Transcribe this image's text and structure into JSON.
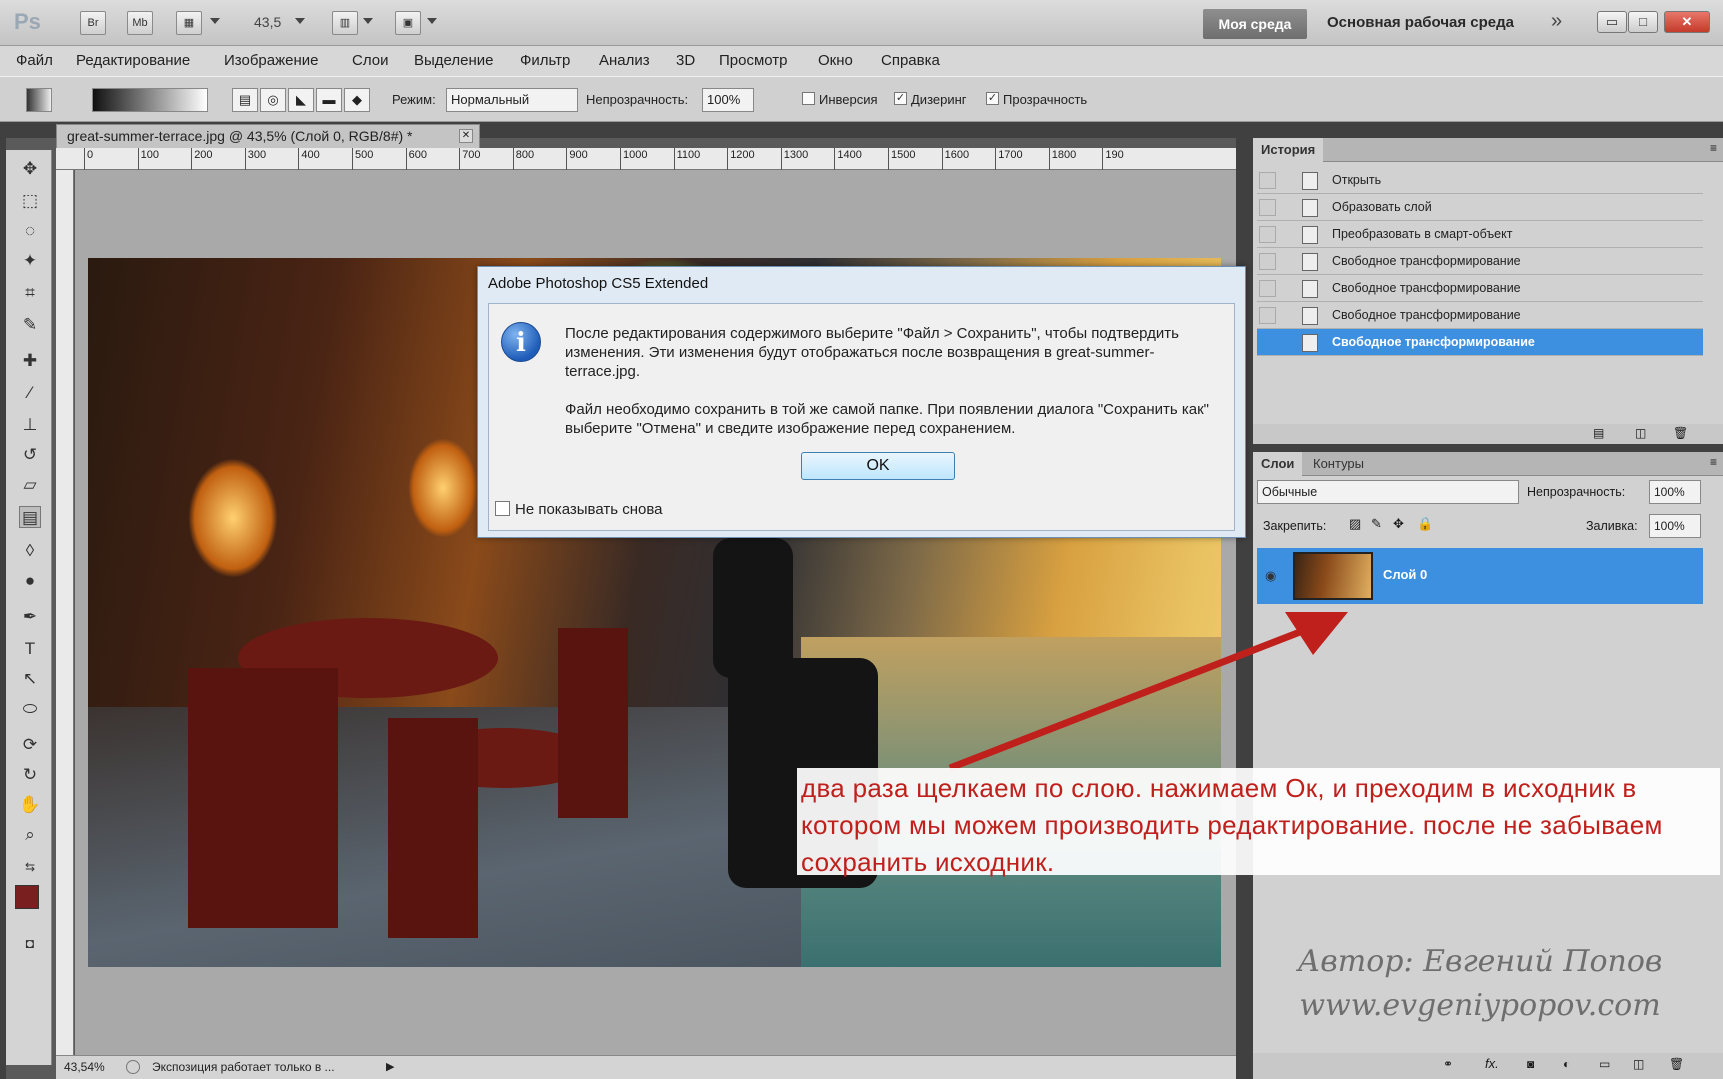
{
  "appbar": {
    "logo": "Ps",
    "buttons": [
      "Br",
      "Mb"
    ],
    "zoom": "43,5",
    "workspace_active": "Моя среда",
    "workspace_main": "Основная рабочая среда",
    "more": "»",
    "win_min": "▭",
    "win_max": "□",
    "win_close": "✕"
  },
  "menu": [
    "Файл",
    "Редактирование",
    "Изображение",
    "Слои",
    "Выделение",
    "Фильтр",
    "Анализ",
    "3D",
    "Просмотр",
    "Окно",
    "Справка"
  ],
  "options": {
    "mode_label": "Режим:",
    "mode_value": "Нормальный",
    "opacity_label": "Непрозрачность:",
    "opacity_value": "100%",
    "inverse_label": "Инверсия",
    "dither_label": "Дизеринг",
    "transparency_label": "Прозрачность",
    "inverse_checked": false,
    "dither_checked": true,
    "transparency_checked": true
  },
  "document": {
    "tab_title": "great-summer-terrace.jpg @ 43,5% (Слой 0, RGB/8#) *",
    "ruler_labels": [
      "0",
      "100",
      "200",
      "300",
      "400",
      "500",
      "600",
      "700",
      "800",
      "900",
      "1000",
      "1100",
      "1200",
      "1300",
      "1400",
      "1500",
      "1600",
      "1700",
      "1800",
      "190"
    ],
    "status_zoom": "43,54%",
    "status_text": "Экспозиция работает только в ..."
  },
  "history": {
    "tabs": [
      "История"
    ],
    "items": [
      "Открыть",
      "Образовать слой",
      "Преобразовать в смарт-объект",
      "Свободное трансформирование",
      "Свободное трансформирование",
      "Свободное трансформирование",
      "Свободное трансформирование"
    ],
    "selected_index": 6
  },
  "layers": {
    "tabs": [
      "Слои",
      "Контуры"
    ],
    "blend_mode": "Обычные",
    "opacity_label": "Непрозрачность:",
    "opacity_value": "100%",
    "lock_label": "Закрепить:",
    "fill_label": "Заливка:",
    "fill_value": "100%",
    "layer_name": "Слой 0"
  },
  "dialog": {
    "title": "Adobe Photoshop CS5 Extended",
    "message1": "После редактирования содержимого выберите \"Файл > Сохранить\", чтобы подтвердить изменения.  Эти изменения будут отображаться после возвращения в great-summer-terrace.jpg.",
    "message2": "Файл необходимо сохранить в той же самой папке. При появлении диалога \"Сохранить как\" выберите \"Отмена\" и сведите изображение перед сохранением.",
    "ok_label": "OK",
    "dont_show_label": "Не показывать снова"
  },
  "annotation": {
    "text": "два раза щелкаем по слою. нажимаем Ок, и преходим в исходник в котором мы можем производить редактирование. после не забываем сохранить исходник."
  },
  "watermark": {
    "line1": "Автор: Евгений Попов",
    "line2": "www.evgeniypopov.com"
  },
  "colors": {
    "accent_selection": "#3d8fe0",
    "annotation_text": "#c0201c",
    "arrow": "#c0201c",
    "foreground_color": "#7a1f1f"
  }
}
